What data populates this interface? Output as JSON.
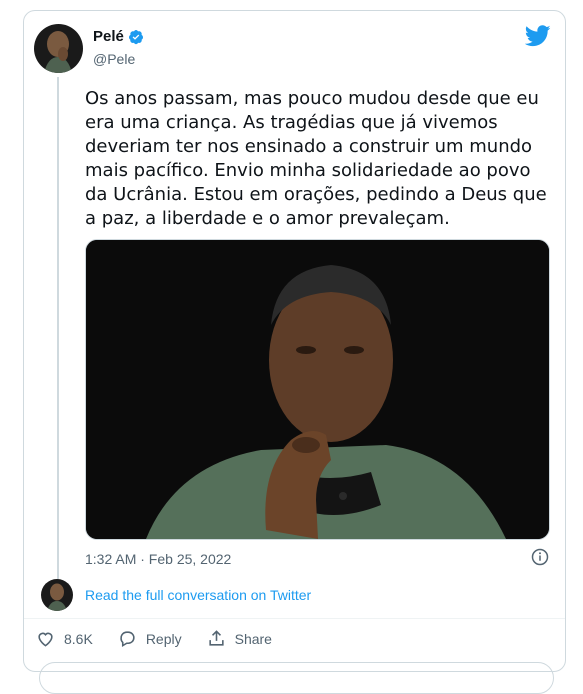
{
  "user": {
    "name": "Pelé",
    "handle": "@Pele"
  },
  "tweet": {
    "text": "Os anos passam, mas pouco mudou desde que eu era uma criança. As tragédias que já vivemos deveriam ter nos ensinado a construir um mundo mais pacífico. Envio minha solidariedade ao povo da Ucrânia. Estou em orações, pedindo a Deus que a paz, a liberdade e o amor prevaleçam.",
    "timestamp": "1:32 AM · Feb 25, 2022"
  },
  "conversation_link": "Read the full conversation on Twitter",
  "actions": {
    "likes": "8.6K",
    "reply_label": "Reply",
    "share_label": "Share"
  },
  "icons": [
    "verified-badge-icon",
    "twitter-bird-icon",
    "info-icon",
    "heart-icon",
    "reply-icon",
    "share-icon"
  ],
  "colors": {
    "accent": "#1d9bf0",
    "secondary_text": "#536471",
    "border": "#cfd9de"
  }
}
